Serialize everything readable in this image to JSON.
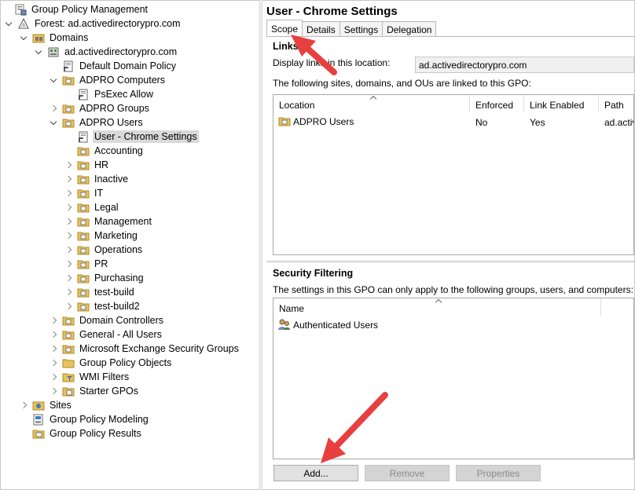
{
  "tree": {
    "root": "Group Policy Management",
    "forest": "Forest: ad.activedirectorypro.com",
    "domains": "Domains",
    "domain": "ad.activedirectorypro.com",
    "default_policy": "Default Domain Policy",
    "adpro_computers": "ADPRO Computers",
    "psexec": "PsExec Allow",
    "adpro_groups": "ADPRO Groups",
    "adpro_users": "ADPRO Users",
    "user_chrome": "User - Chrome Settings",
    "ous": [
      "Accounting",
      "HR",
      "Inactive",
      "IT",
      "Legal",
      "Management",
      "Marketing",
      "Operations",
      "PR",
      "Purchasing",
      "test-build",
      "test-build2"
    ],
    "domain_controllers": "Domain Controllers",
    "general_all_users": "General - All Users",
    "exchange_groups": "Microsoft Exchange Security Groups",
    "gpo_objects": "Group Policy Objects",
    "wmi_filters": "WMI Filters",
    "starter_gpos": "Starter GPOs",
    "sites": "Sites",
    "modeling": "Group Policy Modeling",
    "results": "Group Policy Results"
  },
  "panel": {
    "title": "User - Chrome Settings",
    "tabs": [
      "Scope",
      "Details",
      "Settings",
      "Delegation"
    ],
    "links": {
      "heading": "Links",
      "display_label": "Display links in this location:",
      "location_value": "ad.activedirectorypro.com",
      "description": "The following sites, domains, and OUs are linked to this GPO:",
      "columns": [
        "Location",
        "Enforced",
        "Link Enabled",
        "Path"
      ],
      "rows": [
        {
          "location": "ADPRO Users",
          "enforced": "No",
          "link_enabled": "Yes",
          "path": "ad.activ"
        }
      ]
    },
    "security": {
      "heading": "Security Filtering",
      "description": "The settings in this GPO can only apply to the following groups, users, and computers:",
      "columns": [
        "Name"
      ],
      "rows": [
        "Authenticated Users"
      ]
    },
    "buttons": {
      "add": "Add...",
      "remove": "Remove",
      "properties": "Properties"
    }
  },
  "colors": {
    "arrow": "#e8403e",
    "folder": "#e8c25a",
    "selection": "#d9d9d9"
  }
}
